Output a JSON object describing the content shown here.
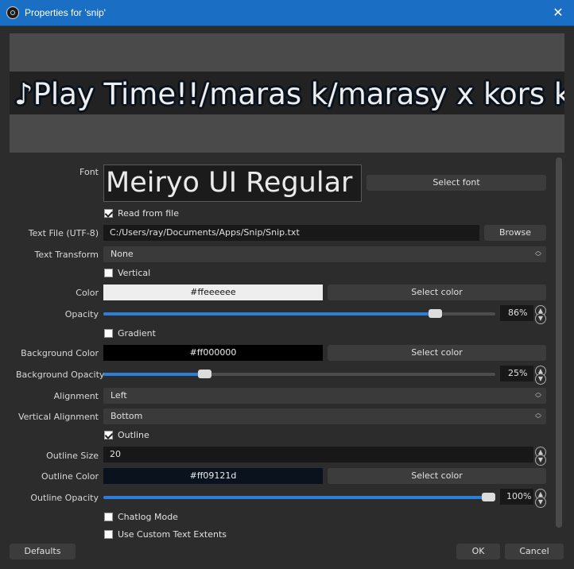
{
  "window": {
    "title": "Properties for 'snip'",
    "close_glyph": "✕"
  },
  "preview": {
    "text": "♪Play Time!!/maras k/marasy x kors k"
  },
  "font": {
    "label": "Font",
    "value": "Meiryo UI Regular",
    "select_label": "Select font"
  },
  "read_from_file": {
    "label": "Read from file",
    "checked": true
  },
  "text_file": {
    "label": "Text File (UTF-8)",
    "value": "C:/Users/ray/Documents/Apps/Snip/Snip.txt",
    "browse_label": "Browse"
  },
  "text_transform": {
    "label": "Text Transform",
    "value": "None"
  },
  "vertical": {
    "label": "Vertical",
    "checked": false
  },
  "color": {
    "label": "Color",
    "value": "#ffeeeeee",
    "select_label": "Select color",
    "swatch": "#eeeeee"
  },
  "opacity": {
    "label": "Opacity",
    "value": "86%",
    "percent": 86
  },
  "gradient": {
    "label": "Gradient",
    "checked": false
  },
  "background_color": {
    "label": "Background Color",
    "value": "#ff000000",
    "select_label": "Select color",
    "swatch": "#000000"
  },
  "background_opacity": {
    "label": "Background Opacity",
    "value": "25%",
    "percent": 25
  },
  "alignment": {
    "label": "Alignment",
    "value": "Left"
  },
  "vertical_alignment": {
    "label": "Vertical Alignment",
    "value": "Bottom"
  },
  "outline": {
    "label": "Outline",
    "checked": true
  },
  "outline_size": {
    "label": "Outline Size",
    "value": "20"
  },
  "outline_color": {
    "label": "Outline Color",
    "value": "#ff09121d",
    "select_label": "Select color",
    "swatch": "#09121d"
  },
  "outline_opacity": {
    "label": "Outline Opacity",
    "value": "100%",
    "percent": 100
  },
  "chatlog_mode": {
    "label": "Chatlog Mode",
    "checked": false
  },
  "custom_extents": {
    "label": "Use Custom Text Extents",
    "checked": false
  },
  "footer": {
    "defaults_label": "Defaults",
    "ok_label": "OK",
    "cancel_label": "Cancel"
  },
  "icons": {
    "spin_up": "▲",
    "spin_down": "▼",
    "combo_up": "︿",
    "combo_down": "﹀"
  }
}
